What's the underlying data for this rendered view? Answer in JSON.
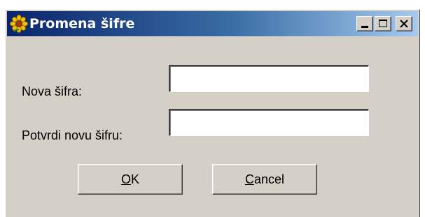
{
  "window": {
    "title": "Promena šifre",
    "icon": "sunflower-icon",
    "title_gradient": [
      "#0a246a",
      "#a6caf0"
    ],
    "face_color": "#d4d0c8"
  },
  "titlebar_buttons": {
    "minimize_icon": "minimize-icon",
    "maximize_icon": "maximize-icon",
    "close_icon": "close-icon"
  },
  "form": {
    "new_password_label": "Nova šifra:",
    "new_password_value": "",
    "confirm_password_label": "Potvrdi novu šifru:",
    "confirm_password_value": ""
  },
  "buttons": {
    "ok_mnemonic": "O",
    "ok_rest": "K",
    "cancel_mnemonic": "C",
    "cancel_rest": "ancel"
  }
}
